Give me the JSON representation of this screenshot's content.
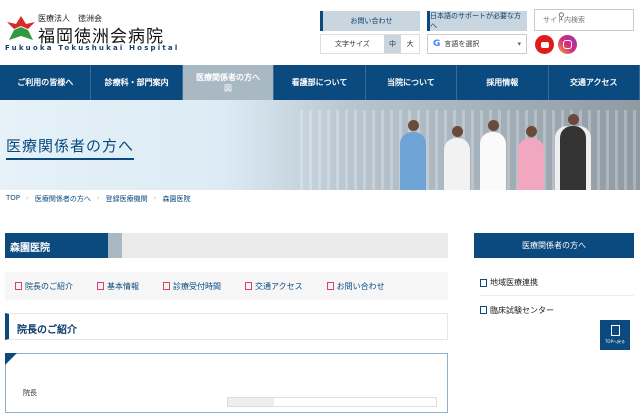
{
  "header": {
    "org": "医療法人　徳洲会",
    "name": "福岡徳洲会病院",
    "name_en": "Fukuoka Tokushukai Hospital",
    "contact": "お問い合わせ",
    "japanese_support": "日本語のサポートが必要な方へ",
    "search_placeholder": "サイト内検索",
    "font_size_label": "文字サイズ",
    "font_mid": "中",
    "font_large": "大",
    "translate": "言語を選択"
  },
  "nav": [
    {
      "label": "ご利用の皆様へ"
    },
    {
      "label": "診療科・部門案内"
    },
    {
      "label": "医療関係者の方へ",
      "sub": "図"
    },
    {
      "label": "看護部について"
    },
    {
      "label": "当院について"
    },
    {
      "label": "採用情報"
    },
    {
      "label": "交通アクセス"
    }
  ],
  "hero": {
    "title": "医療関係者の方へ"
  },
  "breadcrumb": [
    "TOP",
    "医療関係者の方へ",
    "登録医療機関",
    "森園医院"
  ],
  "page_title": "森園医院",
  "anchors": [
    "院長のご紹介",
    "基本情報",
    "診療受付時間",
    "交通アクセス",
    "お問い合わせ"
  ],
  "section": {
    "title": "院長のご紹介",
    "label": "院長"
  },
  "sidebar": {
    "title": "医療関係者の方へ",
    "items": [
      "地域医療連携",
      "臨床試験センター"
    ]
  },
  "totop": "TOPへ戻る",
  "colors": {
    "brand": "#0b4a7e",
    "active_nav": "#a9b9c4"
  }
}
